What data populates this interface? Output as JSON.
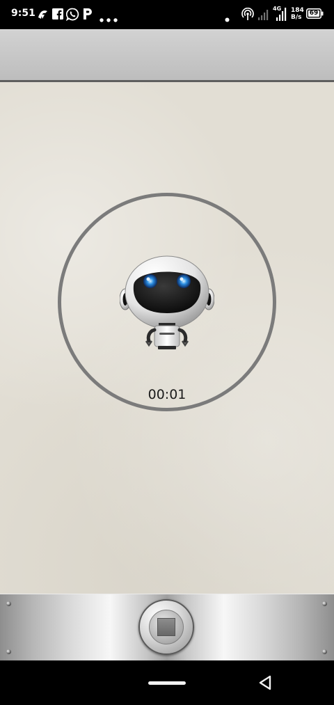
{
  "status_bar": {
    "time": "9:51",
    "network_type": "4G",
    "net_speed_value": "184",
    "net_speed_unit": "B/s",
    "battery": "69",
    "notification_icons": [
      "navigation-app-icon",
      "facebook-icon",
      "whatsapp-icon",
      "p-app-icon",
      "more-dots-icon"
    ],
    "system_icons": [
      "dot-icon",
      "hotspot-icon",
      "signal-icon",
      "signal-4g-icon",
      "battery-icon"
    ]
  },
  "recorder": {
    "elapsed": "00:01",
    "state": "recording"
  },
  "controls": {
    "stop_icon": "stop-icon"
  },
  "nav_bar": {
    "icons": [
      "home-pill-icon",
      "back-triangle-icon"
    ]
  }
}
